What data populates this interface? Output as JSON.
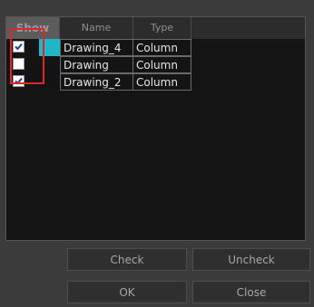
{
  "table": {
    "columns": [
      "Show",
      "Name",
      "Type"
    ],
    "rows": [
      {
        "show": true,
        "name": "Drawing_4",
        "type": "Column",
        "selected": true
      },
      {
        "show": false,
        "name": "Drawing",
        "type": "Column",
        "selected": false
      },
      {
        "show": true,
        "name": "Drawing_2",
        "type": "Column",
        "selected": false
      }
    ]
  },
  "buttons": {
    "check": "Check",
    "uncheck": "Uncheck",
    "ok": "OK",
    "close": "Close"
  },
  "colors": {
    "selection": "#1fb6c8",
    "highlight": "#e0262a"
  }
}
